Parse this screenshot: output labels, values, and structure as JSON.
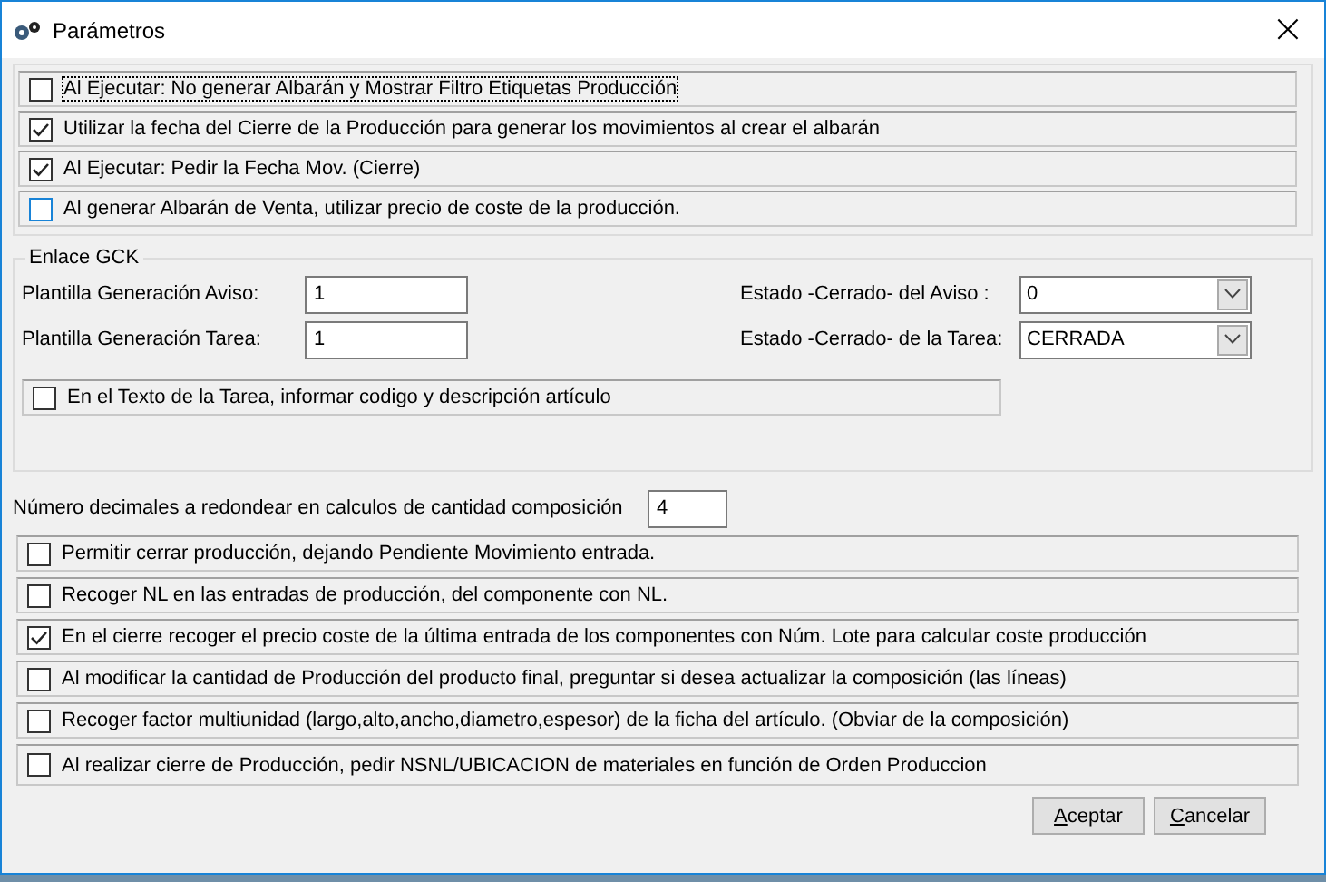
{
  "window": {
    "title": "Parámetros",
    "close": "×"
  },
  "top_options": [
    {
      "label": "Al Ejecutar: No generar Albarán y Mostrar Filtro Etiquetas Producción",
      "checked": false,
      "focused": true
    },
    {
      "label": "Utilizar la fecha del Cierre de la Producción para generar los movimientos al crear el albarán",
      "checked": true,
      "focused": false
    },
    {
      "label": "Al Ejecutar: Pedir la Fecha Mov. (Cierre)",
      "checked": true,
      "focused": false
    },
    {
      "label": "Al generar Albarán de Venta, utilizar precio de coste de la producción.",
      "checked": false,
      "focused": false
    }
  ],
  "gck": {
    "title": "Enlace GCK",
    "fields": [
      {
        "label": "Plantilla Generación Aviso:",
        "value": "1",
        "select_label": "Estado -Cerrado- del Aviso :",
        "select_value": "0"
      },
      {
        "label": "Plantilla Generación Tarea:",
        "value": "1",
        "select_label": "Estado -Cerrado- de la Tarea:",
        "select_value": "CERRADA"
      }
    ],
    "option": {
      "label": "En el Texto de la Tarea, informar codigo y descripción artículo",
      "checked": false
    }
  },
  "decimals": {
    "label": "Número decimales a redondear en calculos de cantidad composición",
    "value": "4"
  },
  "bottom_options": [
    {
      "label": "Permitir cerrar producción, dejando Pendiente Movimiento entrada.",
      "checked": false
    },
    {
      "label": "Recoger NL en las entradas de producción, del componente con NL.",
      "checked": false
    },
    {
      "label": "En el cierre recoger el precio coste de la última entrada de los componentes con Núm. Lote para calcular coste producción",
      "checked": true
    },
    {
      "label": "Al modificar la cantidad de Producción del producto final, preguntar si desea actualizar la composición (las líneas)",
      "checked": false
    },
    {
      "label": "Recoger factor multiunidad (largo,alto,ancho,diametro,espesor) de la ficha del artículo. (Obviar de la composición)",
      "checked": false
    },
    {
      "label": "Al realizar cierre de Producción, pedir NSNL/UBICACION de materiales en función de Orden Produccion",
      "checked": false
    }
  ],
  "buttons": [
    "Aceptar",
    "Cancelar"
  ]
}
